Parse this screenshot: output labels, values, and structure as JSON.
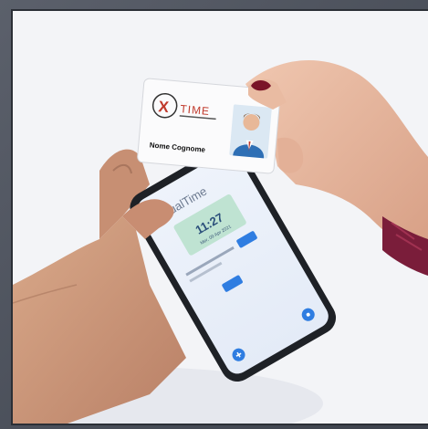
{
  "card": {
    "brand_x": "X",
    "brand_name": "TIME",
    "holder_name": "Nome Cognome"
  },
  "phone": {
    "app_title": "VirtualTime",
    "clock_time": "11:27",
    "clock_date": "Mer, 09 Apr 2021"
  },
  "colors": {
    "background": "#f3f4f7",
    "card_red": "#c0392b",
    "app_blue": "#2f7de1",
    "clock_green": "#bfe3d2",
    "nail_polish": "#7a1428"
  }
}
